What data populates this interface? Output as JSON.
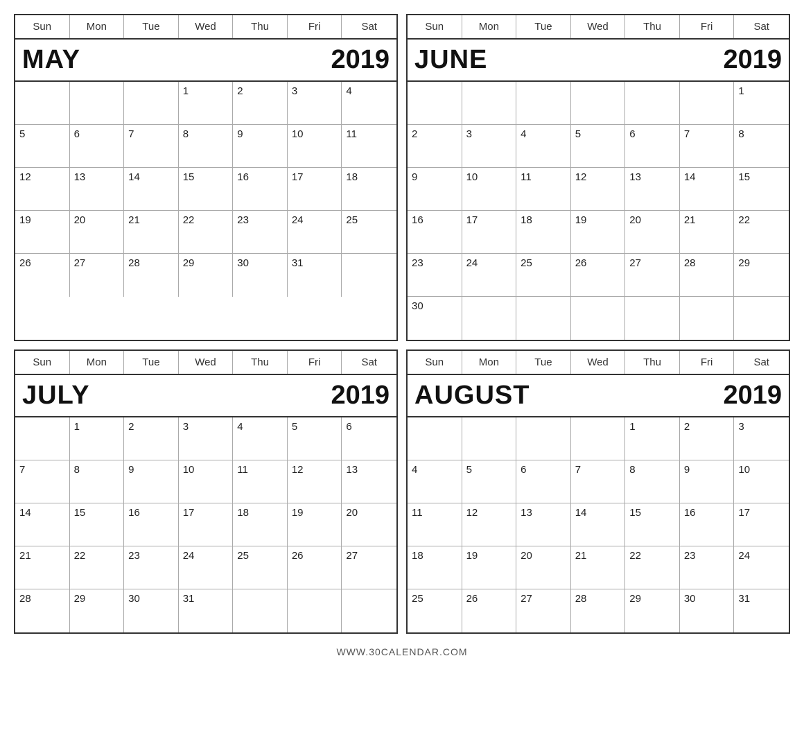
{
  "footer": "WWW.30CALENDAR.COM",
  "dayHeaders": [
    "Sun",
    "Mon",
    "Tue",
    "Wed",
    "Thu",
    "Fri",
    "Sat"
  ],
  "months": [
    {
      "name": "MAY",
      "year": "2019",
      "startDay": 3,
      "totalDays": 31,
      "rows": 6
    },
    {
      "name": "JUNE",
      "year": "2019",
      "startDay": 6,
      "totalDays": 30,
      "rows": 6
    },
    {
      "name": "JULY",
      "year": "2019",
      "startDay": 1,
      "totalDays": 31,
      "rows": 5
    },
    {
      "name": "AUGUST",
      "year": "2019",
      "startDay": 4,
      "totalDays": 31,
      "rows": 5
    }
  ]
}
